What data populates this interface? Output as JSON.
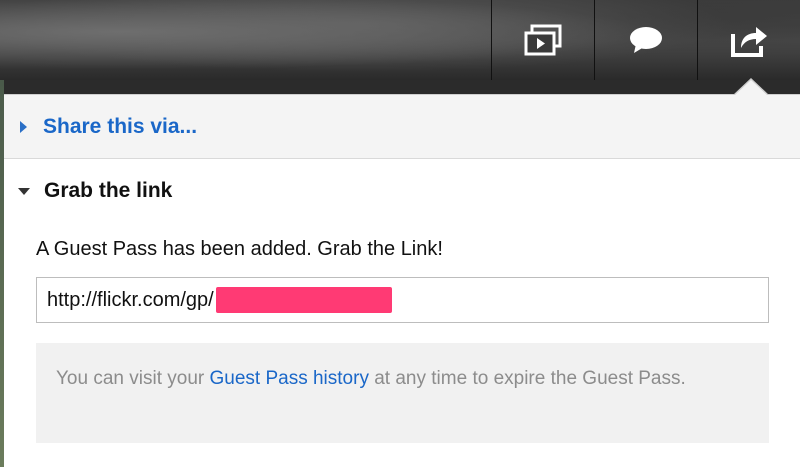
{
  "toolbar": {
    "buttons": [
      {
        "name": "slideshow",
        "icon": "slideshow-icon"
      },
      {
        "name": "comments",
        "icon": "speech-bubble-icon"
      },
      {
        "name": "share",
        "icon": "share-arrow-icon"
      }
    ]
  },
  "share_panel": {
    "share_via_label": "Share this via...",
    "grab_link_label": "Grab the link",
    "guest_pass_message": "A Guest Pass has been added. Grab the Link!",
    "link_value_prefix": "http://flickr.com/gp/",
    "link_redacted": true,
    "note_before": "You can visit your ",
    "note_link": "Guest Pass history",
    "note_after": " at any time to expire the Guest Pass."
  },
  "colors": {
    "link_blue": "#1a67c8",
    "redaction": "#ff3a74",
    "note_bg": "#f1f1f1"
  }
}
